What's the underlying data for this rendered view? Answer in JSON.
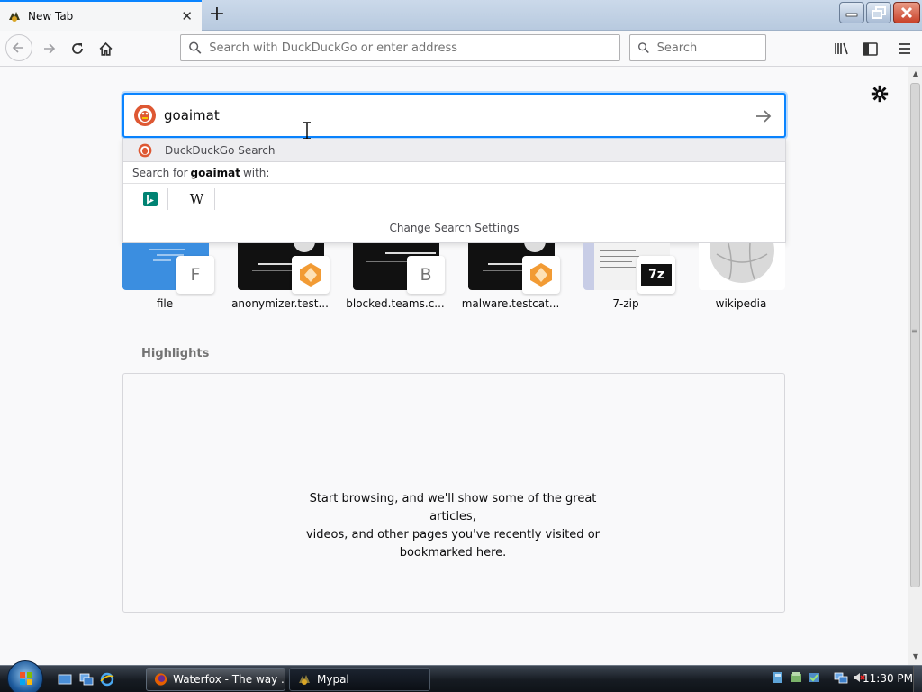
{
  "tab": {
    "title": "New Tab",
    "favicon": "waterfox-icon"
  },
  "toolbar": {
    "url_placeholder": "Search with DuckDuckGo or enter address",
    "search_placeholder": "Search"
  },
  "search": {
    "query": "goaimat",
    "engine_icon": "duckduckgo-icon"
  },
  "dropdown": {
    "engine_label": "DuckDuckGo Search",
    "search_for_prefix": "Search for",
    "search_for_query": "goaimat",
    "search_for_suffix": "with:",
    "engines": [
      {
        "name": "bing",
        "glyph": "b"
      },
      {
        "name": "wikipedia",
        "glyph": "W"
      }
    ],
    "settings_label": "Change Search Settings"
  },
  "topsites": [
    {
      "title": "file",
      "badge": "F"
    },
    {
      "title": "anonymizer.test...",
      "badge": ""
    },
    {
      "title": "blocked.teams.c...",
      "badge": "B"
    },
    {
      "title": "malware.testcat...",
      "badge": ""
    },
    {
      "title": "7-zip",
      "badge": "7z"
    },
    {
      "title": "wikipedia",
      "badge": ""
    }
  ],
  "highlights": {
    "title": "Highlights",
    "message_line1": "Start browsing, and we'll show some of the great articles,",
    "message_line2": "videos, and other pages you've recently visited or",
    "message_line3": "bookmarked here."
  },
  "taskbar": {
    "tasks": [
      {
        "label": "Waterfox - The way ..."
      },
      {
        "label": "Mypal"
      }
    ],
    "clock": "11:30 PM"
  },
  "colors": {
    "accent": "#0a84ff",
    "ddg": "#de5833"
  }
}
